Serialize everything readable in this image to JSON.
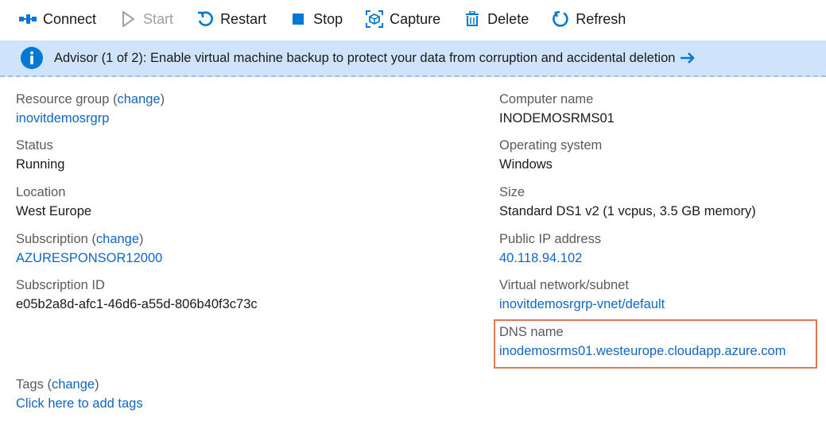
{
  "toolbar": {
    "connect": "Connect",
    "start": "Start",
    "restart": "Restart",
    "stop": "Stop",
    "capture": "Capture",
    "delete": "Delete",
    "refresh": "Refresh"
  },
  "advisor": {
    "message": "Advisor (1 of 2): Enable virtual machine backup to protect your data from corruption and accidental deletion"
  },
  "left": {
    "resource_group": {
      "label": "Resource group",
      "paren_open": " (",
      "change": "change",
      "paren_close": ")",
      "value": "inovitdemosrgrp"
    },
    "status": {
      "label": "Status",
      "value": "Running"
    },
    "location": {
      "label": "Location",
      "value": "West Europe"
    },
    "subscription": {
      "label": "Subscription",
      "paren_open": " (",
      "change": "change",
      "paren_close": ")",
      "value": "AZURESPONSOR12000"
    },
    "subscription_id": {
      "label": "Subscription ID",
      "value": "e05b2a8d-afc1-46d6-a55d-806b40f3c73c"
    }
  },
  "right": {
    "computer_name": {
      "label": "Computer name",
      "value": "INODEMOSRMS01"
    },
    "os": {
      "label": "Operating system",
      "value": "Windows"
    },
    "size": {
      "label": "Size",
      "value": "Standard DS1 v2 (1 vcpus, 3.5 GB memory)"
    },
    "public_ip": {
      "label": "Public IP address",
      "value": "40.118.94.102"
    },
    "vnet": {
      "label": "Virtual network/subnet",
      "value": "inovitdemosrgrp-vnet/default"
    },
    "dns": {
      "label": "DNS name",
      "value": "inodemosrms01.westeurope.cloudapp.azure.com"
    }
  },
  "tags": {
    "label": "Tags",
    "paren_open": " (",
    "change": "change",
    "paren_close": ")",
    "value": "Click here to add tags"
  },
  "colors": {
    "link": "#1066c4",
    "banner_bg": "#cfe4fa",
    "accent": "#0078d4",
    "highlight_box": "#e07a55"
  },
  "icons": [
    "connect-icon",
    "start-icon",
    "restart-icon",
    "stop-icon",
    "capture-icon",
    "delete-icon",
    "refresh-icon",
    "info-icon",
    "arrow-right-icon"
  ]
}
